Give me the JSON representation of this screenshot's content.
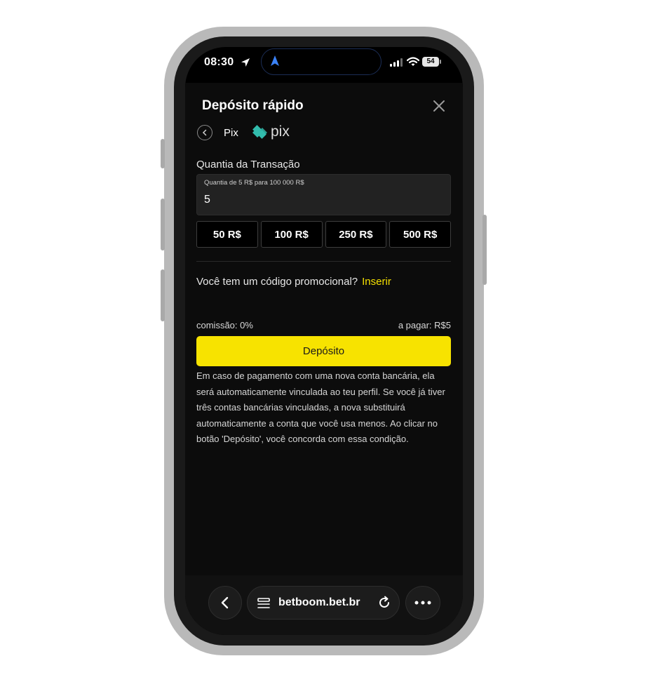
{
  "status_bar": {
    "time": "08:30",
    "battery": "54"
  },
  "sheet": {
    "title": "Depósito rápido",
    "method": "Pix",
    "logo_text": "pix",
    "amount_label": "Quantia da Transação",
    "amount_hint": "Quantia de 5 R$ para 100 000 R$",
    "amount_value": "5",
    "quick_amounts": [
      "50 R$",
      "100 R$",
      "250 R$",
      "500 R$"
    ],
    "promo_question": "Você tem um código promocional?",
    "promo_link": "Inserir",
    "commission": "comissão: 0%",
    "to_pay": "a pagar: R$5",
    "deposit_label": "Depósito",
    "notice": "Em caso de pagamento com uma nova conta bancária, ela será automaticamente vinculada ao teu perfil. Se você já tiver três contas bancárias vinculadas, a nova substituirá automaticamente a conta que você usa menos. Ao clicar no botão 'Depósito', você concorda com essa condição."
  },
  "browser": {
    "url": "betboom.bet.br"
  },
  "colors": {
    "accent": "#f7e300",
    "pix_teal": "#32bcad",
    "background": "#0c0c0c"
  },
  "icons": [
    "location-arrow-icon",
    "navigation-icon",
    "signal-icon",
    "wifi-icon",
    "close-icon",
    "chevron-left-icon",
    "pix-logo-icon",
    "tabs-icon",
    "reload-icon",
    "more-icon"
  ]
}
